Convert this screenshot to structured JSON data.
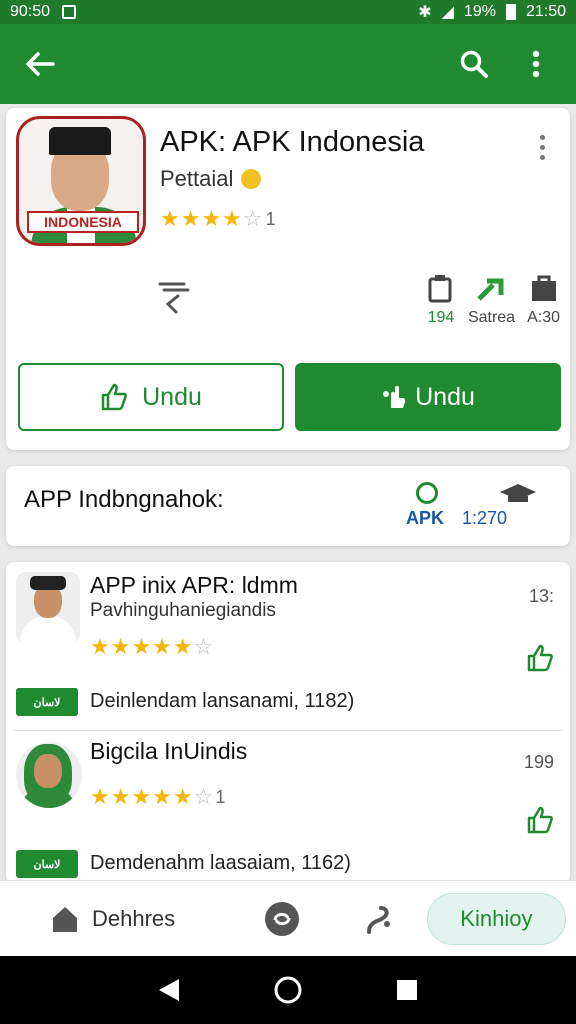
{
  "status_bar": {
    "time_left": "90:50",
    "battery": "19%",
    "time_right": "21:50"
  },
  "colors": {
    "primary": "#1f8a2f",
    "status": "#1f7a2c",
    "star": "#f5b50a",
    "link": "#1a56a8"
  },
  "app_bar": {
    "back_icon": "arrow-left-icon",
    "search_icon": "search-icon",
    "menu_icon": "more-vert-icon"
  },
  "app": {
    "title": "APK: APK Indonesia",
    "developer": "Pettaial",
    "icon_label": "INDONESIA",
    "rating": 4,
    "rating_count": "1",
    "stats": [
      {
        "value": "194",
        "label": ""
      },
      {
        "value": "",
        "label": "Satrea"
      },
      {
        "value": "",
        "label": "A:30"
      }
    ],
    "buttons": {
      "outline": "Undu",
      "fill": "Undu"
    }
  },
  "banner": {
    "title": "APP Indbngnahok:",
    "badge_text": "APK",
    "badge_num": "1:270"
  },
  "list": [
    {
      "title": "APP inix APR: ldmm",
      "subtitle": "Pavhinguhaniegiandis",
      "rating": 4.5,
      "right_num": "13:",
      "badge": "لاسان",
      "footer": "Deinlendam lansanami, 1182)"
    },
    {
      "title": "Bigcila InUindis",
      "rating": 4.5,
      "rating_count": "1",
      "right_num": "199",
      "badge": "لاسان",
      "footer": "Demdenahm laasaiam, 1162)"
    }
  ],
  "bottom_nav": {
    "home_label": "Dehhres",
    "pill_label": "Kinhioy"
  }
}
